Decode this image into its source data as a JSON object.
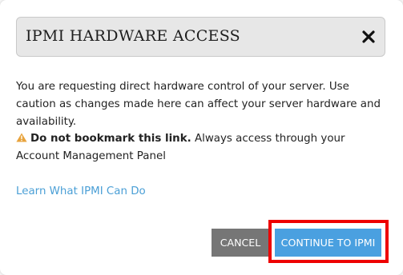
{
  "dialog": {
    "title": "IPMI HARDWARE ACCESS",
    "close_icon": "close-x-icon",
    "message": "You are requesting direct hardware control of your server. Use caution as changes made here can affect your server hardware and availability.",
    "warning": {
      "icon": "warning-triangle-icon",
      "icon_color": "#e8a33d",
      "bold_text": "Do not bookmark this link.",
      "text": " Always access through your Account Management Panel"
    },
    "learn_link": "Learn What IPMI Can Do",
    "buttons": {
      "cancel_label": "CANCEL",
      "continue_label": "CONTINUE TO IPMI"
    }
  },
  "colors": {
    "link": "#4a9fd6",
    "cancel_button": "#767676",
    "continue_button": "#4aa0e0",
    "highlight_border": "#ee0000"
  }
}
